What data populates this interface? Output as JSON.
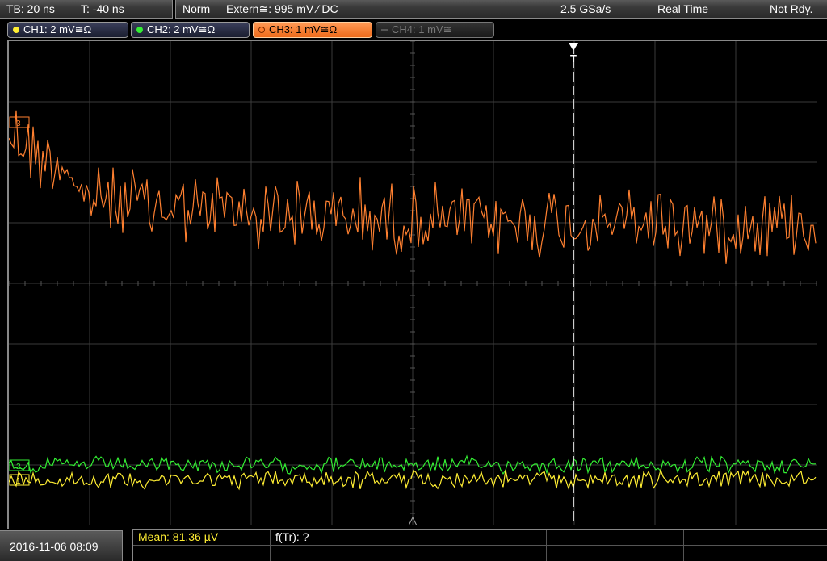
{
  "status": {
    "timebase": "TB: 20 ns",
    "trigger_time": "T: -40 ns",
    "mode": "Norm",
    "trigger_source": "Extern≅: 995 mV ⁄ DC",
    "sample_rate": "2.5 GSa/s",
    "acq_mode": "Real Time",
    "state": "Not Rdy."
  },
  "channels": [
    {
      "label": "CH1: 2 mV≅Ω",
      "color": "#ffee33",
      "active": true
    },
    {
      "label": "CH2: 2 mV≅Ω",
      "color": "#33ee33",
      "active": true
    },
    {
      "label": "CH3: 1 mV≅Ω",
      "color": "#ff8030",
      "active": true,
      "selected": true
    },
    {
      "label": "CH4: 1 mV≅",
      "color": "#777777",
      "active": false
    }
  ],
  "markers": {
    "trigger_marker": "T",
    "ch3_marker": "3",
    "ch2_marker": "2",
    "ch1_marker": "1"
  },
  "measurements": {
    "mean": "Mean: 81.36 µV",
    "ftr": "f(Tr): ?"
  },
  "datetime": "2016-11-06 08:09",
  "colors": {
    "ch1": "#ffee33",
    "ch2": "#33ee33",
    "ch3": "#ff8030",
    "grid": "#3a3a3a",
    "trigger_line": "#ffffff"
  }
}
